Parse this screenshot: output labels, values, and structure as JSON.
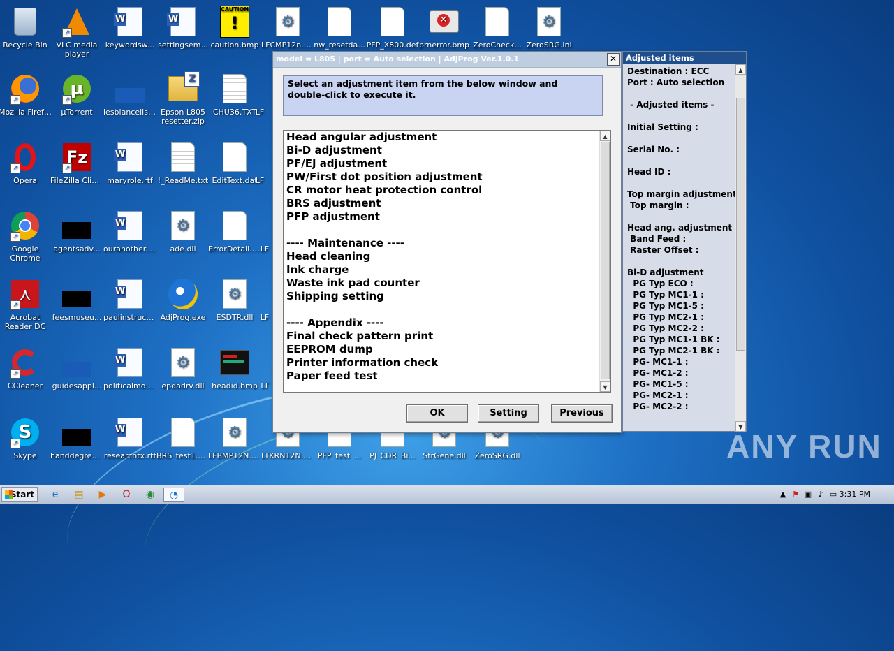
{
  "desktop_icons": [
    {
      "label": "Recycle Bin",
      "icon": "recycle-bin-icon"
    },
    {
      "label": "VLC media player",
      "icon": "vlc-icon"
    },
    {
      "label": "keywordsw...",
      "icon": "word-doc-icon"
    },
    {
      "label": "settingsem...",
      "icon": "word-doc-icon"
    },
    {
      "label": "caution.bmp",
      "icon": "caution-icon",
      "image_text": "CAUTION"
    },
    {
      "label": "LFCMP12n.DLL",
      "icon": "dll-icon"
    },
    {
      "label": "nw_resetda...",
      "icon": "file-icon"
    },
    {
      "label": "PFP_X800.def",
      "icon": "file-icon"
    },
    {
      "label": "prnerror.bmp",
      "icon": "printer-error-icon"
    },
    {
      "label": "ZeroCheck...",
      "icon": "file-icon"
    },
    {
      "label": "ZeroSRG.ini",
      "icon": "settings-file-icon"
    },
    {
      "label": "Mozilla Firefox",
      "icon": "firefox-icon"
    },
    {
      "label": "µTorrent",
      "icon": "utorrent-icon"
    },
    {
      "label": "lesbiancells....",
      "icon": "blank-image-icon"
    },
    {
      "label": "Epson L805 resetter.zip",
      "icon": "zip-folder-icon"
    },
    {
      "label": "CHU36.TXT",
      "icon": "text-file-icon"
    },
    {
      "label": "LF",
      "icon": "dll-icon"
    },
    {
      "label": "Opera",
      "icon": "opera-icon"
    },
    {
      "label": "FileZilla Client",
      "icon": "filezilla-icon"
    },
    {
      "label": "maryrole.rtf",
      "icon": "word-doc-icon"
    },
    {
      "label": "!_ReadMe.txt",
      "icon": "text-file-icon"
    },
    {
      "label": "EditText.dat",
      "icon": "file-icon"
    },
    {
      "label": "LF",
      "icon": "dll-icon"
    },
    {
      "label": "Google Chrome",
      "icon": "chrome-icon"
    },
    {
      "label": "agentsadv...",
      "icon": "black-image-icon"
    },
    {
      "label": "ouranother.rtf",
      "icon": "word-doc-icon"
    },
    {
      "label": "ade.dll",
      "icon": "dll-icon"
    },
    {
      "label": "ErrorDetail.dat",
      "icon": "file-icon"
    },
    {
      "label": "LF",
      "icon": "dll-icon"
    },
    {
      "label": "Acrobat Reader DC",
      "icon": "acrobat-icon"
    },
    {
      "label": "feesmuseu...",
      "icon": "black-image-icon"
    },
    {
      "label": "paulinstructi...",
      "icon": "word-doc-icon"
    },
    {
      "label": "AdjProg.exe",
      "icon": "adjprog-icon"
    },
    {
      "label": "ESDTR.dll",
      "icon": "dll-icon"
    },
    {
      "label": "LF",
      "icon": "dll-icon"
    },
    {
      "label": "CCleaner",
      "icon": "ccleaner-icon"
    },
    {
      "label": "guidesappl...",
      "icon": "blank-image-icon"
    },
    {
      "label": "politicalmoni...",
      "icon": "word-doc-icon"
    },
    {
      "label": "epdadrv.dll",
      "icon": "dll-icon"
    },
    {
      "label": "headid.bmp",
      "icon": "bitmap-icon"
    },
    {
      "label": "LT",
      "icon": "dll-icon"
    },
    {
      "label": "Skype",
      "icon": "skype-icon"
    },
    {
      "label": "handdegree...",
      "icon": "black-image-icon"
    },
    {
      "label": "researchtx.rtf",
      "icon": "word-doc-icon"
    },
    {
      "label": "BRS_test1.prn",
      "icon": "file-icon"
    },
    {
      "label": "LFBMP12N.DLL",
      "icon": "dll-icon"
    },
    {
      "label": "LTKRN12N.DLL",
      "icon": "dll-icon"
    },
    {
      "label": "PFP_test_...",
      "icon": "file-icon"
    },
    {
      "label": "PJ_CDR_Bi...",
      "icon": "file-icon"
    },
    {
      "label": "StrGene.dll",
      "icon": "dll-icon"
    },
    {
      "label": "ZeroSRG.dll",
      "icon": "dll-icon"
    }
  ],
  "window": {
    "title": "model = L805 | port = Auto selection | AdjProg Ver.1.0.1",
    "close_label": "✕",
    "instruction": "Select an adjustment item from the below window and double-click to execute it.",
    "list_items": [
      "Head angular adjustment",
      "Bi-D adjustment",
      "PF/EJ adjustment",
      "PW/First dot position adjustment",
      "CR motor heat protection control",
      "BRS adjustment",
      "PFP adjustment",
      "",
      "---- Maintenance ----",
      "Head cleaning",
      "Ink charge",
      "Waste ink pad counter",
      "Shipping setting",
      "",
      "---- Appendix ----",
      "Final check pattern print",
      "EEPROM dump",
      "Printer information check",
      "Paper feed test"
    ],
    "buttons": {
      "ok": "OK",
      "setting": "Setting",
      "previous": "Previous"
    }
  },
  "adjusted_panel": {
    "title": "Adjusted items",
    "lines": [
      "Destination : ECC",
      "Port : Auto selection",
      "",
      " - Adjusted items -",
      "",
      "Initial Setting :",
      "",
      "Serial No. :",
      "",
      "Head ID :",
      "",
      "Top margin adjustment",
      " Top margin :",
      "",
      "Head ang. adjustment",
      " Band Feed :",
      " Raster Offset :",
      "",
      "Bi-D adjustment",
      "  PG Typ ECO :",
      "  PG Typ MC1-1 :",
      "  PG Typ MC1-5 :",
      "  PG Typ MC2-1 :",
      "  PG Typ MC2-2 :",
      "  PG Typ MC1-1 BK :",
      "  PG Typ MC2-1 BK :",
      "  PG- MC1-1 :",
      "  PG- MC1-2 :",
      "  PG- MC1-5 :",
      "  PG- MC2-1 :",
      "  PG- MC2-2 :"
    ]
  },
  "taskbar": {
    "start_label": "Start",
    "clock": "3:31 PM",
    "pinned": [
      "internet-explorer-icon",
      "explorer-icon",
      "media-player-icon",
      "opera-icon",
      "chrome-icon",
      "adjprog-icon"
    ]
  },
  "watermark": "ANY RUN"
}
